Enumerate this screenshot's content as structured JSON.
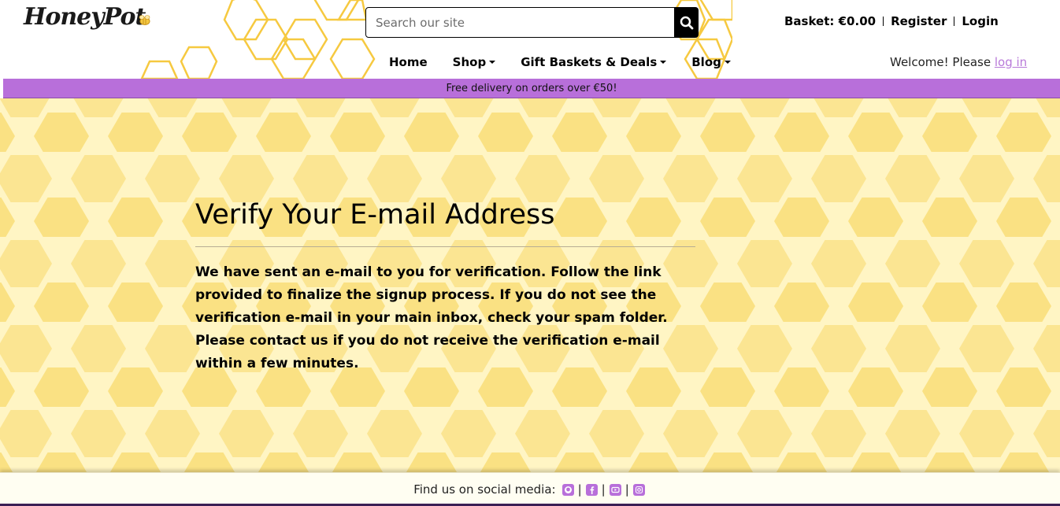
{
  "header": {
    "logo_text": "HoneyPot",
    "search": {
      "placeholder": "Search our site",
      "value": ""
    },
    "account": {
      "basket": "Basket: €0.00",
      "register": "Register",
      "login": "Login"
    },
    "nav": [
      {
        "label": "Home"
      },
      {
        "label": "Shop"
      },
      {
        "label": "Gift Baskets & Deals"
      },
      {
        "label": "Blog"
      }
    ],
    "welcome": {
      "text": "Welcome! Please ",
      "link": "log in"
    }
  },
  "banner": {
    "text": "Free delivery on orders over €50!"
  },
  "main": {
    "title": "Verify Your E-mail Address",
    "message": "We have sent an e-mail to you for verification. Follow the link provided to finalize the signup process. If you do not see the verification e-mail in your main inbox, check your spam folder. Please contact us if you do not receive the verification e-mail within a few minutes."
  },
  "footer": {
    "text": "Find us on social media:",
    "icons": [
      "github-icon",
      "facebook-icon",
      "youtube-icon",
      "instagram-icon"
    ]
  },
  "colors": {
    "accent_purple": "#b86fda",
    "honey_yellow": "#f5c842",
    "background_cream": "#fff6c9"
  }
}
